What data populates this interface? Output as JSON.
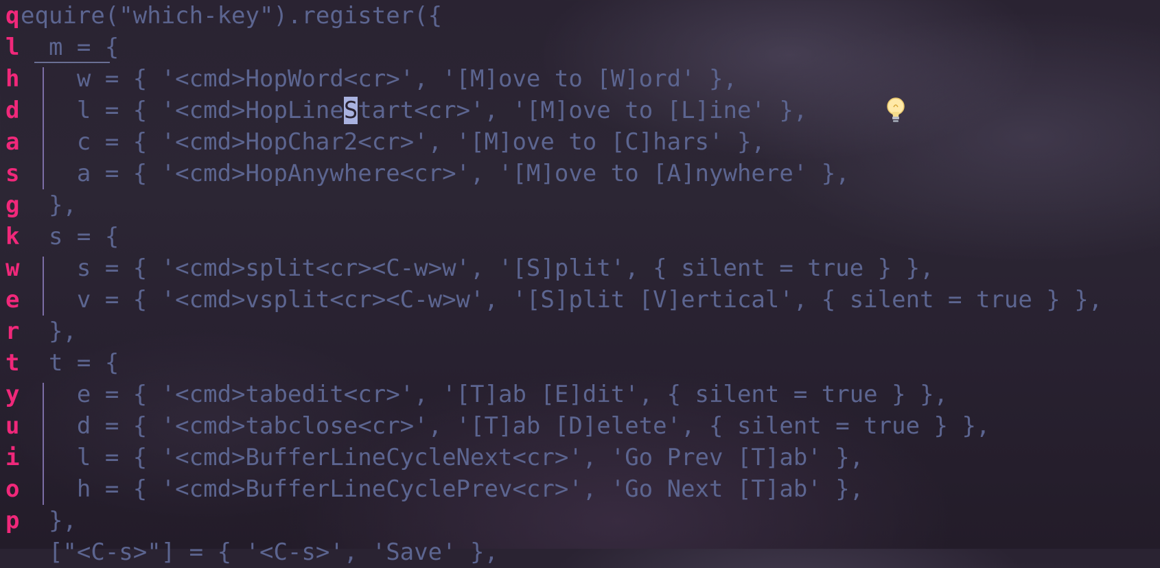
{
  "editor": {
    "hints": [
      "q",
      "l",
      "h",
      "d",
      "a",
      "s",
      "g",
      "k",
      "w",
      "e",
      "r",
      "t",
      "y",
      "u",
      "i",
      "o",
      "p"
    ],
    "lines": [
      "equire(\"which-key\").register({",
      "  m = {",
      "    w = { '<cmd>HopWord<cr>', '[M]ove to [W]ord' },",
      "    l = { '<cmd>HopLine",
      "    c = { '<cmd>HopChar2<cr>', '[M]ove to [C]hars' },",
      "    a = { '<cmd>HopAnywhere<cr>', '[M]ove to [A]nywhere' },",
      "  },",
      "  s = {",
      "    s = { '<cmd>split<cr><C-w>w', '[S]plit', { silent = true } },",
      "    v = { '<cmd>vsplit<cr><C-w>w', '[S]plit [V]ertical', { silent = true } },",
      "  },",
      "  t = {",
      "    e = { '<cmd>tabedit<cr>', '[T]ab [E]dit', { silent = true } },",
      "    d = { '<cmd>tabclose<cr>', '[T]ab [D]elete', { silent = true } },",
      "    l = { '<cmd>BufferLineCycleNext<cr>', 'Go Prev [T]ab' },",
      "    h = { '<cmd>BufferLineCyclePrev<cr>', 'Go Next [T]ab' },",
      "  },",
      "  [\"<C-s>\"] = { '<C-s>', 'Save' },"
    ],
    "cursor_char": "S",
    "cursor_rest": "tart<cr>', '[M]ove to [L]ine' },",
    "lightbulb_icon": "lightbulb-icon"
  },
  "colors": {
    "hint": "#f0287a",
    "code": "#5c6590",
    "guide": "#7c6ea6"
  }
}
